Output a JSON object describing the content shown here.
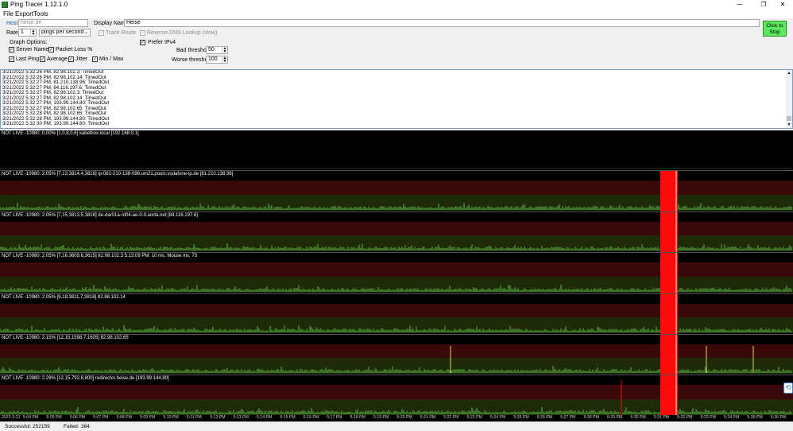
{
  "window": {
    "title": "Ping Tracer 1.12.1.0",
    "controls": {
      "minimize": "—",
      "maximize": "❐",
      "close": "✕"
    }
  },
  "menu": [
    "File",
    "Export",
    "Tools"
  ],
  "toolbar": {
    "host_label": "Host:",
    "host_value": "heise.de",
    "display_name_label": "Display Name:",
    "display_name_value": "Heise",
    "rate_label": "Rate:",
    "rate_value": "1",
    "rate_unit": "pings per second",
    "trace_route_label": "Trace Route",
    "trace_route_checked": true,
    "reverse_dns_label": "Reverse DNS Lookup (slow)",
    "reverse_dns_checked": true,
    "prefer_ipv4_label": "Prefer IPv4",
    "prefer_ipv4_checked": true,
    "graph_options_label": "Graph Options:",
    "server_names_label": "Server Names",
    "packet_loss_label": "Packet Loss %",
    "last_ping_label": "Last Ping",
    "average_label": "Average",
    "jitter_label": "Jitter",
    "min_max_label": "Min / Max",
    "bad_threshold_label": "Bad threshold:",
    "bad_threshold_value": "50",
    "worse_threshold_label": "Worse threshold:",
    "worse_threshold_value": "100",
    "stop_button_line1": "Click to",
    "stop_button_line2": "Stop",
    "stop_button_color": "#5ce85c"
  },
  "log_lines": [
    "3/21/2022 5:32:26 PM, 82.98.102.3: TimedOut",
    "3/21/2022 5:32:26 PM, 82.98.102.14: TimedOut",
    "3/21/2022 5:32:27 PM, 81.210.138.96: TimedOut",
    "3/21/2022 5:32:27 PM, 84.116.197.6: TimedOut",
    "3/21/2022 5:32:27 PM, 82.98.102.3: TimedOut",
    "3/21/2022 5:32:27 PM, 82.98.102.14: TimedOut",
    "3/21/2022 5:32:27 PM, 193.99.144.80: TimedOut",
    "3/21/2022 5:32:27 PM, 82.98.102.65: TimedOut",
    "3/21/2022 5:32:28 PM, 82.98.102.65: TimedOut",
    "3/21/2022 5:32:28 PM, 193.99.144.80: TimedOut",
    "3/21/2022 5:32:30 PM, 193.99.144.80: TimedOut"
  ],
  "graphs": [
    {
      "header": "NOT LIVE -10980: 0.00% [1,0,8,0,6] kabelbox.local [192.168.0.1]"
    },
    {
      "header": "NOT LIVE -10980: 2.05% [7,13,3814,4,3818] ip-081-210-138-096.um21.pools.vodafone-ip.de [81.210.138.96]"
    },
    {
      "header": "NOT LIVE -10980: 2.05% [7,15,3813,5,3818] de-dar01a-rd04-ae-0-0.aorta.net [84.116.197.6]"
    },
    {
      "header": "NOT LIVE -10980: 2.05% [7,16,3609,6,3615] 82.98.102.3 5:13:09 PM: 10 ms, Mouse ms: 73"
    },
    {
      "header": "NOT LIVE -10980: 2.05% [9,18,3811,7,3818] 82.98.102.14"
    },
    {
      "header": "NOT LIVE -10980: 2.15% [12,15,1598,7,1605] 82.98.102.65"
    },
    {
      "header": "NOT LIVE -10980: 2.29% [12,15,792,8,800] redirector.heise.de [193.99.144.80]"
    }
  ],
  "colors": {
    "bad_band": "#3a0808",
    "ok_band": "#1e2a08",
    "ping_line": "#5fbf4a",
    "timeout": "#ff0a0a",
    "cursor": "#ffffcc"
  },
  "time_axis": [
    "2022-3-21",
    "5:04 PM",
    "5:05 PM",
    "5:06 PM",
    "5:07 PM",
    "5:08 PM",
    "5:09 PM",
    "5:10 PM",
    "5:11 PM",
    "5:12 PM",
    "5:13 PM",
    "5:14 PM",
    "5:15 PM",
    "5:16 PM",
    "5:17 PM",
    "5:18 PM",
    "5:19 PM",
    "5:20 PM",
    "5:21 PM",
    "5:22 PM",
    "5:23 PM",
    "5:24 PM",
    "5:25 PM",
    "5:26 PM",
    "5:27 PM",
    "5:28 PM",
    "5:29 PM",
    "5:30 PM",
    "5:31 PM",
    "5:32 PM",
    "5:33 PM",
    "5:34 PM",
    "5:35 PM",
    "5:36 PM",
    "5:37 PM"
  ],
  "status": {
    "successful_label": "Successful:",
    "successful_value": "252159",
    "failed_label": "Failed:",
    "failed_value": "384"
  }
}
